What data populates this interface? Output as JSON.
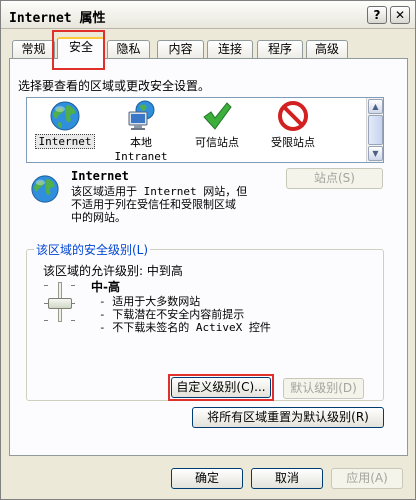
{
  "window": {
    "title": "Internet 属性",
    "help_label": "?",
    "close_label": "✕"
  },
  "tabs": [
    {
      "label": "常规"
    },
    {
      "label": "安全"
    },
    {
      "label": "隐私"
    },
    {
      "label": "内容"
    },
    {
      "label": "连接"
    },
    {
      "label": "程序"
    },
    {
      "label": "高级"
    }
  ],
  "security": {
    "instruction": "选择要查看的区域或更改安全设置。",
    "zones": [
      {
        "label": "Internet",
        "icon": "globe-icon",
        "selected": true
      },
      {
        "label": "本地",
        "sublabel": "Intranet",
        "icon": "local-intranet-icon"
      },
      {
        "label": "可信站点",
        "icon": "green-check-icon"
      },
      {
        "label": "受限站点",
        "icon": "restricted-icon"
      }
    ],
    "zone_detail": {
      "title": "Internet",
      "description_lines": [
        "该区域适用于 Internet 网站，但",
        "不适用于列在受信任和受限制区域",
        "中的网站。"
      ],
      "sites_button": "站点(S)"
    },
    "level_group": {
      "title": "该区域的安全级别(L)",
      "allowed": "该区域的允许级别: 中到高",
      "level_name": "中-高",
      "details": [
        "- 适用于大多数网站",
        "- 下载潜在不安全内容前提示",
        "- 不下载未签名的 ActiveX 控件"
      ],
      "custom_button": "自定义级别(C)...",
      "default_button": "默认级别(D)"
    },
    "reset_all_button": "将所有区域重置为默认级别(R)"
  },
  "footer": {
    "ok": "确定",
    "cancel": "取消",
    "apply": "应用(A)"
  },
  "colors": {
    "highlight": "#e0302c",
    "tab_accent": "#ffc83c",
    "group_title": "#0046d5"
  }
}
